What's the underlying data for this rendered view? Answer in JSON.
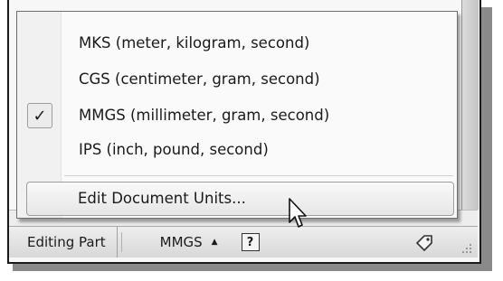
{
  "unit_menu": {
    "items": [
      {
        "label": "MKS (meter, kilogram, second)",
        "checked": false
      },
      {
        "label": "CGS (centimeter, gram, second)",
        "checked": false
      },
      {
        "label": "MMGS (millimeter, gram, second)",
        "checked": true
      },
      {
        "label": "IPS (inch, pound, second)",
        "checked": false
      }
    ],
    "check_mark": "✓",
    "edit_label": "Edit Document Units..."
  },
  "status_bar": {
    "mode": "Editing Part",
    "units": "MMGS",
    "units_arrow": "▲",
    "help_glyph": "?"
  },
  "icons": {
    "units_arrow": "triangle-up-icon",
    "help": "help-icon",
    "tag": "tag-icon",
    "cursor": "mouse-pointer-icon",
    "grip": "resize-grip-icon"
  }
}
